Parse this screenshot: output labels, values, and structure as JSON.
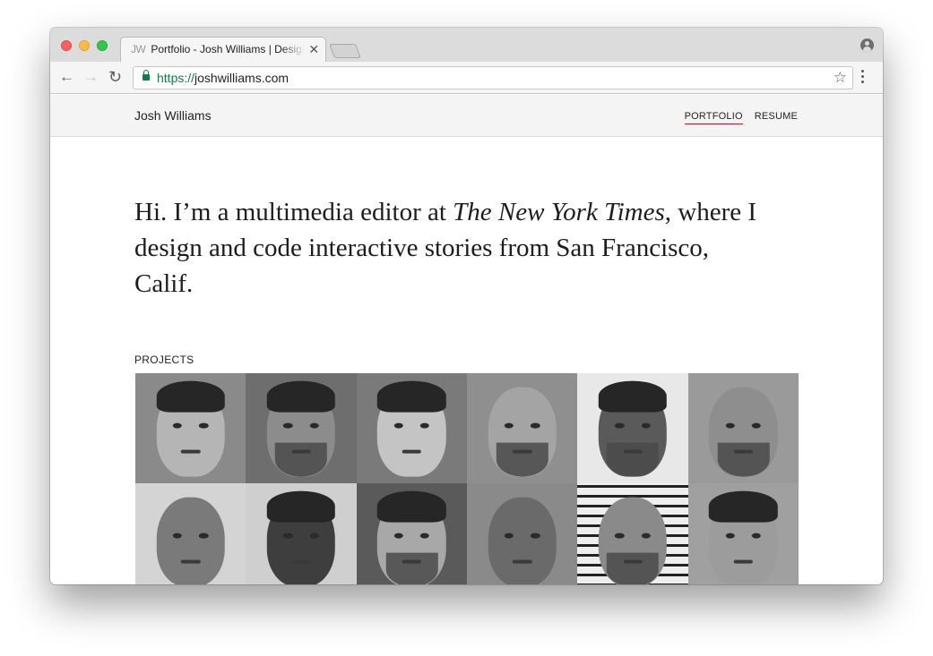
{
  "browser": {
    "tab": {
      "favicon_text": "JW",
      "title": "Portfolio - Josh Williams | Designer"
    },
    "url": {
      "protocol": "https://",
      "host": "joshwilliams.com"
    }
  },
  "site": {
    "name": "Josh Williams",
    "nav": [
      {
        "label": "PORTFOLIO",
        "active": true
      },
      {
        "label": "RESUME",
        "active": false
      }
    ]
  },
  "intro": {
    "part1": "Hi. I’m a multimedia editor at ",
    "publication": "The New York Times",
    "part2": ", where I design and code interactive stories from San Francisco, Calif."
  },
  "projects": {
    "label": "PROJECTS",
    "tiles": [
      {
        "bg": "#8a8a8a",
        "skin": "#b5b5b5",
        "hair": true,
        "beard": false,
        "stripes": false
      },
      {
        "bg": "#6e6e6e",
        "skin": "#8c8c8c",
        "hair": true,
        "beard": true,
        "stripes": false
      },
      {
        "bg": "#7a7a7a",
        "skin": "#c4c4c4",
        "hair": true,
        "beard": false,
        "stripes": false
      },
      {
        "bg": "#8f8f8f",
        "skin": "#a4a4a4",
        "hair": false,
        "beard": true,
        "stripes": false
      },
      {
        "bg": "#e8e8e8",
        "skin": "#5a5a5a",
        "hair": true,
        "beard": true,
        "stripes": false
      },
      {
        "bg": "#9a9a9a",
        "skin": "#8e8e8e",
        "hair": false,
        "beard": true,
        "stripes": false
      },
      {
        "bg": "#d4d4d4",
        "skin": "#7a7a7a",
        "hair": false,
        "beard": false,
        "stripes": false
      },
      {
        "bg": "#cfcfcf",
        "skin": "#3e3e3e",
        "hair": true,
        "beard": false,
        "stripes": false
      },
      {
        "bg": "#5a5a5a",
        "skin": "#a8a8a8",
        "hair": true,
        "beard": true,
        "stripes": false
      },
      {
        "bg": "#8a8a8a",
        "skin": "#6a6a6a",
        "hair": false,
        "beard": false,
        "stripes": false
      },
      {
        "bg": "#bdbdbd",
        "skin": "#8a8a8a",
        "hair": false,
        "beard": true,
        "stripes": true
      },
      {
        "bg": "#a0a0a0",
        "skin": "#9c9c9c",
        "hair": true,
        "beard": false,
        "stripes": false
      }
    ]
  }
}
